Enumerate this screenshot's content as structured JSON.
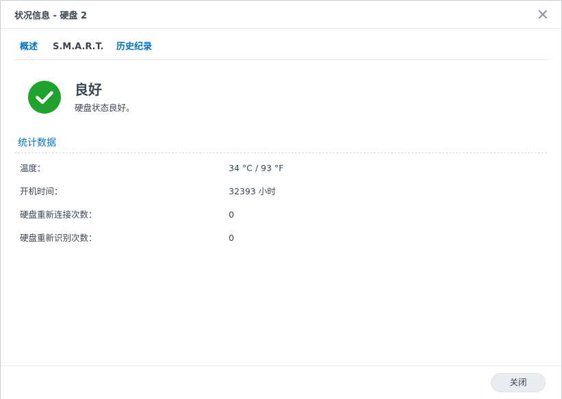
{
  "window": {
    "title": "状况信息 - 硬盘 2",
    "close_icon": "close-icon"
  },
  "tabs": [
    {
      "label": "概述",
      "active": true
    },
    {
      "label": "S.M.A.R.T.",
      "active": false
    },
    {
      "label": "历史纪录",
      "active": false
    }
  ],
  "status": {
    "icon": "check-circle-icon",
    "color": "#1fa32e",
    "title": "良好",
    "description": "硬盘状态良好。"
  },
  "statistics": {
    "section_title": "统计数据",
    "rows": [
      {
        "label": "温度：",
        "value": "34 °C / 93 °F"
      },
      {
        "label": "开机时间：",
        "value": "32393 小时"
      },
      {
        "label": "硬盘重新连接次数：",
        "value": "0"
      },
      {
        "label": "硬盘重新识别次数：",
        "value": "0"
      }
    ]
  },
  "footer": {
    "close_label": "关闭"
  },
  "colors": {
    "accent": "#0073c5",
    "text": "#3a4552",
    "success": "#1fa32e"
  }
}
